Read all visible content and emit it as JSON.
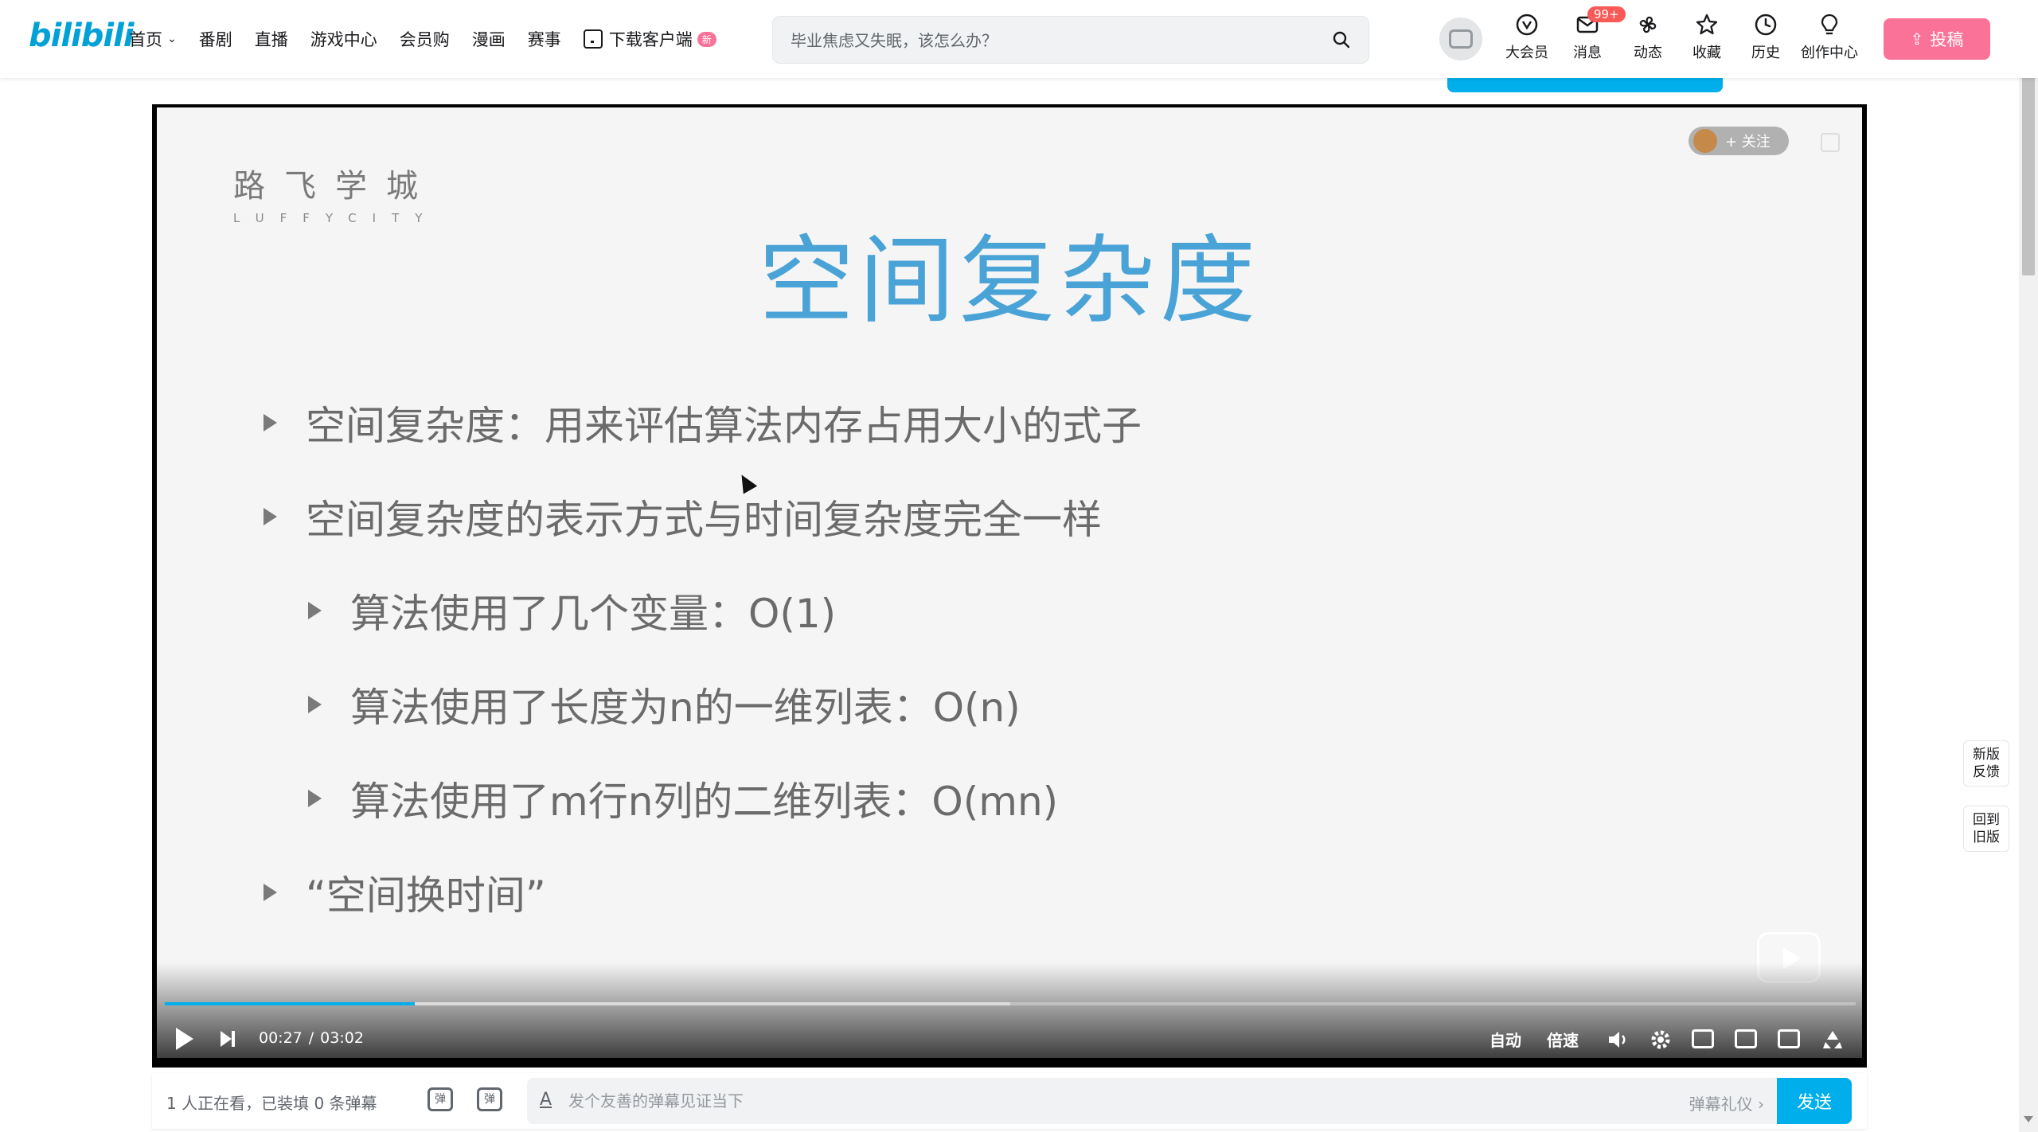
{
  "header": {
    "logo": "bilibili",
    "nav": [
      {
        "label": "首页",
        "has_dropdown": true
      },
      {
        "label": "番剧"
      },
      {
        "label": "直播"
      },
      {
        "label": "游戏中心"
      },
      {
        "label": "会员购"
      },
      {
        "label": "漫画"
      },
      {
        "label": "赛事"
      },
      {
        "label": "下载客户端",
        "badge": "新"
      }
    ],
    "search_placeholder": "毕业焦虑又失眠，该怎么办？",
    "buttons": {
      "vip": "大会员",
      "messages": "消息",
      "messages_badge": "99+",
      "dynamic": "动态",
      "favorites": "收藏",
      "history": "历史",
      "creator": "创作中心"
    },
    "upload": "投稿",
    "accent": "#00aeec",
    "pink": "#fb7299"
  },
  "player": {
    "follow_chip": "+ 关注",
    "slide": {
      "brand_cn": "路飞学城",
      "brand_en": "LUFFYCITY",
      "title": "空间复杂度",
      "bullets": [
        "空间复杂度：用来评估算法内存占用大小的式子",
        "空间复杂度的表示方式与时间复杂度完全一样",
        "算法使用了几个变量：O(1)",
        "算法使用了长度为n的一维列表：O(n)",
        "算法使用了m行n列的二维列表：O(mn)",
        "“空间换时间”"
      ]
    },
    "controls": {
      "current_time": "00:27",
      "separator": "/",
      "duration": "03:02",
      "quality": "自动",
      "speed": "倍速",
      "progress_fraction": 0.148,
      "buffered_fraction": 0.5
    }
  },
  "danmaku": {
    "info": "1 人正在看，已装填 0 条弹幕",
    "placeholder": "发个友善的弹幕见证当下",
    "etiquette": "弹幕礼仪 ›",
    "send": "发送"
  },
  "side": {
    "feedback": "新版\n反馈",
    "old_version": "回到\n旧版"
  }
}
